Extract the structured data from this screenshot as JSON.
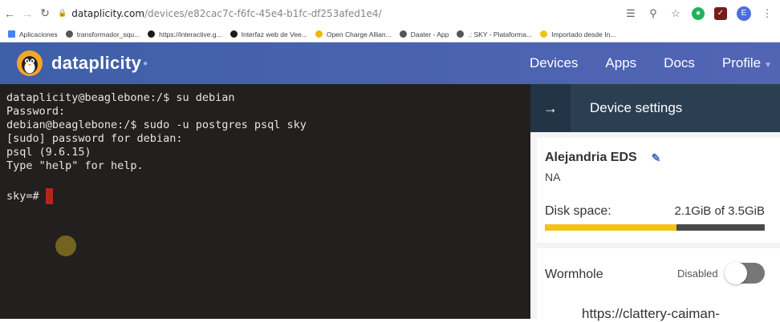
{
  "browser": {
    "url_host": "dataplicity.com",
    "url_path": "/devices/e82cac7c-f6fc-45e4-b1fc-df253afed1e4/",
    "avatar_letter": "E",
    "bookmarks": [
      {
        "label": "Aplicaciones",
        "color": "#4285f4"
      },
      {
        "label": "transformador_squ...",
        "color": "#555555"
      },
      {
        "label": "https://interactive.g...",
        "color": "#1a1a1a"
      },
      {
        "label": "Interfaz web de Vee...",
        "color": "#1a1a1a"
      },
      {
        "label": "Open Charge Allian...",
        "color": "#f4b400"
      },
      {
        "label": "Daater - App",
        "color": "#555555"
      },
      {
        "label": ".: SKY - Plataforma...",
        "color": "#555555"
      },
      {
        "label": "Importado desde In...",
        "color": "#f4c20d"
      }
    ]
  },
  "header": {
    "brand": "dataplicity",
    "nav": [
      "Devices",
      "Apps",
      "Docs",
      "Profile"
    ]
  },
  "terminal": {
    "lines": [
      "dataplicity@beaglebone:/$ su debian",
      "Password:",
      "debian@beaglebone:/$ sudo -u postgres psql sky",
      "[sudo] password for debian:",
      "psql (9.6.15)",
      "Type \"help\" for help."
    ],
    "prompt": "sky=#"
  },
  "sidebar": {
    "title": "Device settings",
    "device_name": "Alejandria EDS",
    "device_sub": "NA",
    "disk_label": "Disk space:",
    "disk_value": "2.1GiB of 3.5GiB",
    "disk_used_fraction": 0.6,
    "wormhole_label": "Wormhole",
    "wormhole_state": "Disabled",
    "wormhole_url": "https://clattery-caiman-"
  },
  "colors": {
    "header_bg": "#4b63b0",
    "terminal_bg": "#221f1e",
    "sidebar_head": "#2b3f52",
    "disk_fill": "#f2c11a",
    "cursor": "#b3261e"
  }
}
